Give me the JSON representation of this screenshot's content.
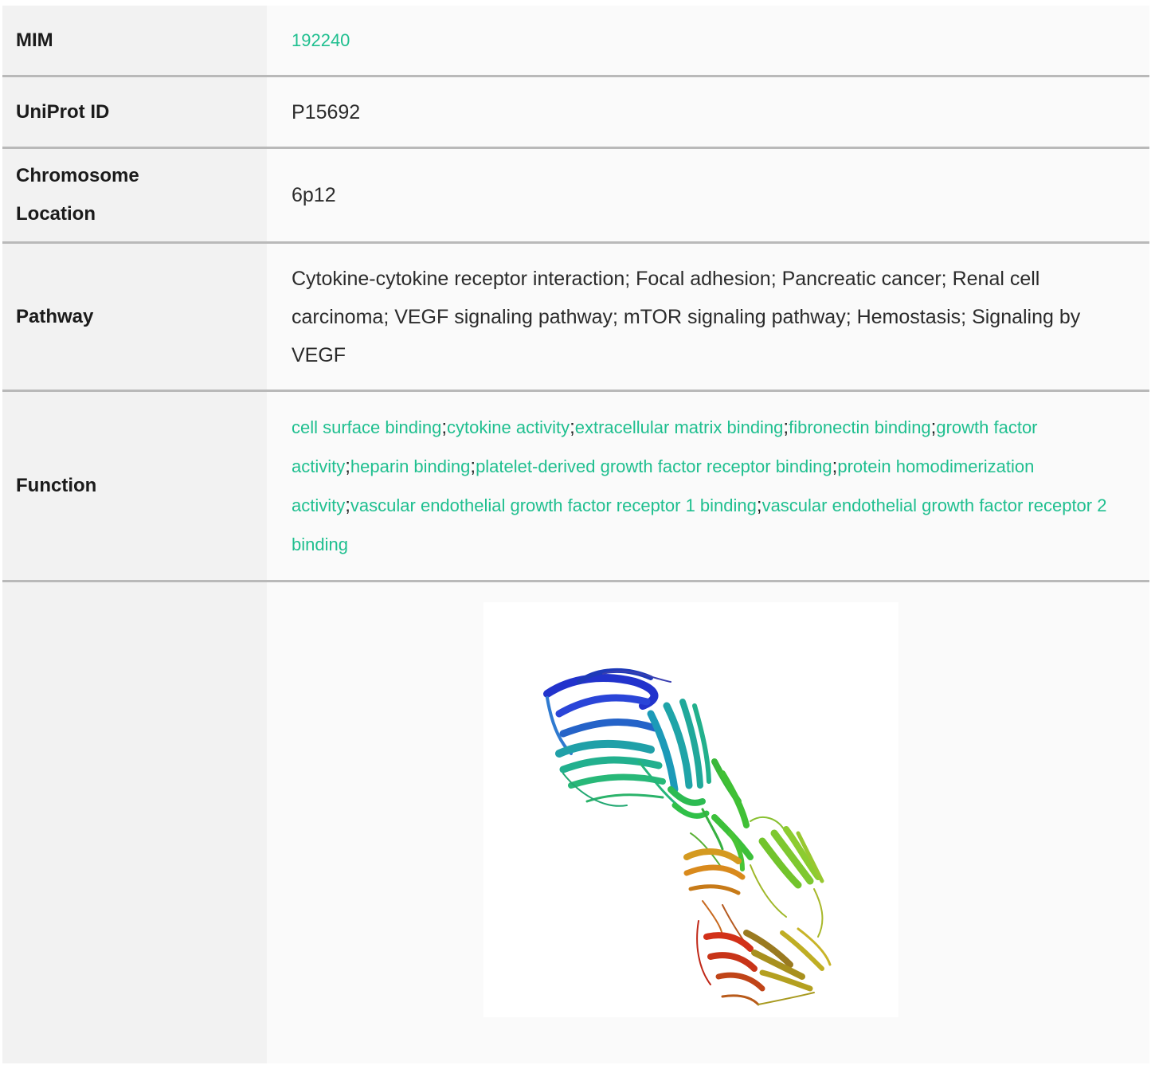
{
  "rows": {
    "mim": {
      "label": "MIM",
      "value": "192240"
    },
    "uniprot": {
      "label": "UniProt ID",
      "value": "P15692"
    },
    "chromosome": {
      "label_line1": "Chromosome",
      "label_line2": "Location",
      "value": "6p12"
    },
    "pathway": {
      "label": "Pathway",
      "value": "Cytokine-cytokine receptor interaction; Focal adhesion; Pancreatic cancer; Renal cell carcinoma; VEGF signaling pathway; mTOR signaling pathway; Hemostasis; Signaling by VEGF"
    },
    "function": {
      "label": "Function",
      "terms": [
        "cell surface binding",
        "cytokine activity",
        "extracellular matrix binding",
        "fibronectin binding",
        "growth factor activity",
        "heparin binding",
        "platelet-derived growth factor receptor binding",
        "protein homodimerization activity",
        "vascular endothelial growth factor receptor 1 binding",
        "vascular endothelial growth factor receptor 2 binding"
      ],
      "separator": ";"
    }
  },
  "colors": {
    "link": "#1fbf8f",
    "label_bg": "#f2f2f2",
    "value_bg": "#fafafa",
    "divider": "#b9b9b9"
  },
  "image": {
    "description_icon": "protein-structure-ribbon"
  }
}
